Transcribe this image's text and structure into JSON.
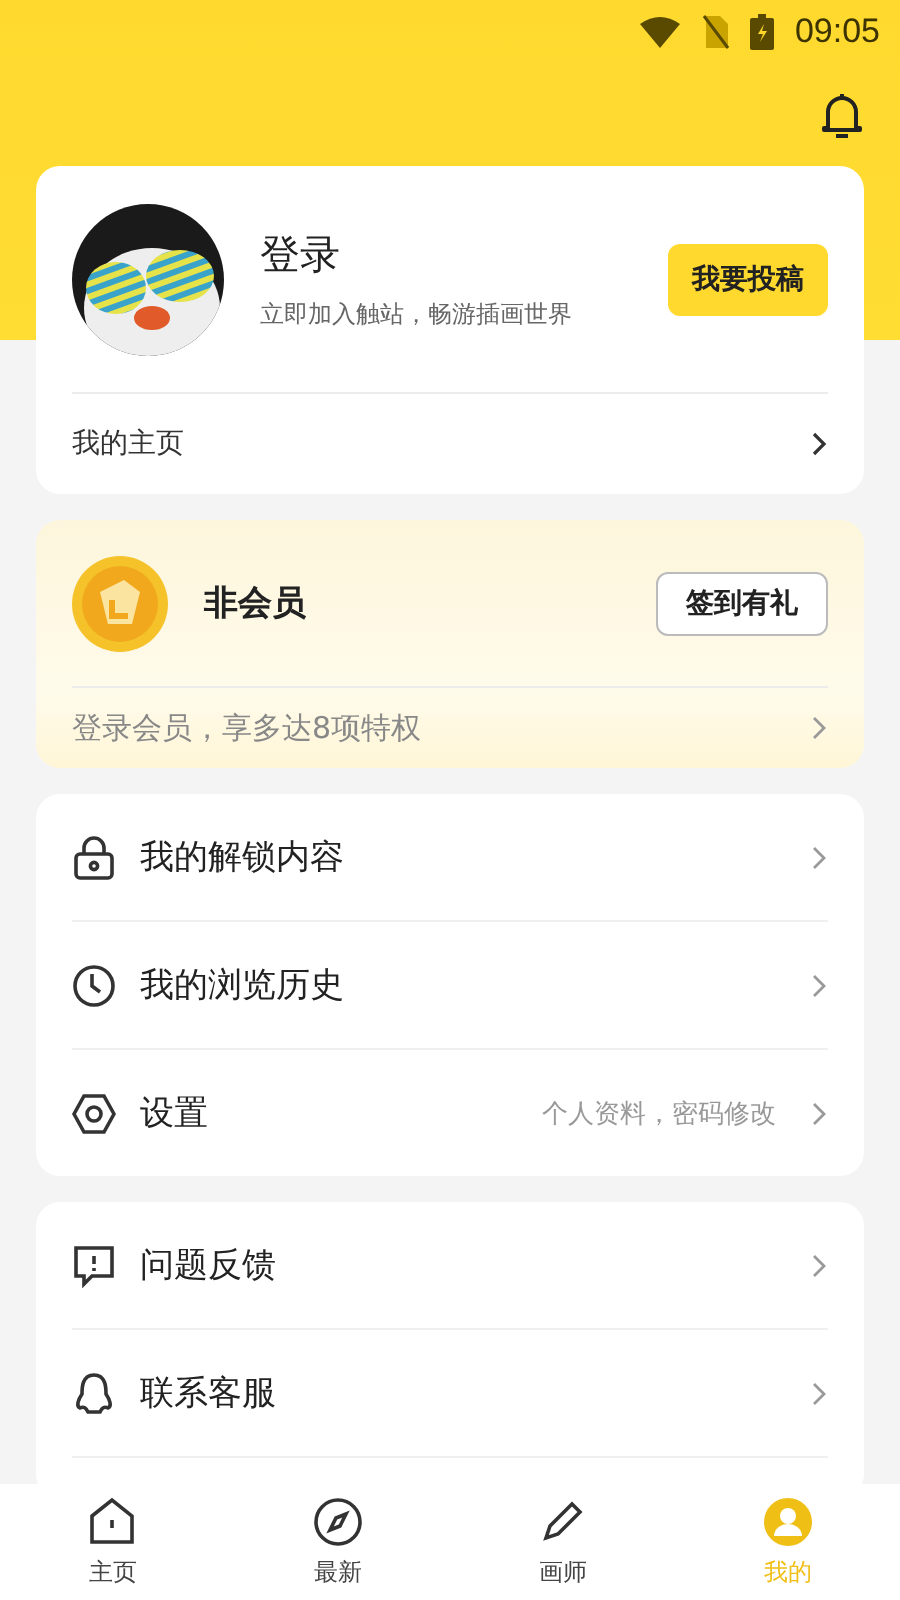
{
  "status_bar": {
    "time": "09:05"
  },
  "profile": {
    "name": "登录",
    "subtitle": "立即加入触站，畅游插画世界",
    "submit_button": "我要投稿",
    "homepage_link": "我的主页"
  },
  "membership": {
    "title": "非会员",
    "checkin_button": "签到有礼",
    "promo": "登录会员，享多达8项特权"
  },
  "menu_groups": [
    [
      {
        "kind": "lock",
        "label": "我的解锁内容"
      },
      {
        "kind": "clock",
        "label": "我的浏览历史"
      },
      {
        "kind": "hexagon",
        "label": "设置",
        "hint": "个人资料，密码修改"
      }
    ],
    [
      {
        "kind": "feedback",
        "label": "问题反馈"
      },
      {
        "kind": "penguin",
        "label": "联系客服"
      }
    ]
  ],
  "bottom_nav": [
    {
      "kind": "home",
      "label": "主页",
      "selected": false
    },
    {
      "kind": "compass",
      "label": "最新",
      "selected": false
    },
    {
      "kind": "pen",
      "label": "画师",
      "selected": false
    },
    {
      "kind": "me",
      "label": "我的",
      "selected": true
    }
  ]
}
